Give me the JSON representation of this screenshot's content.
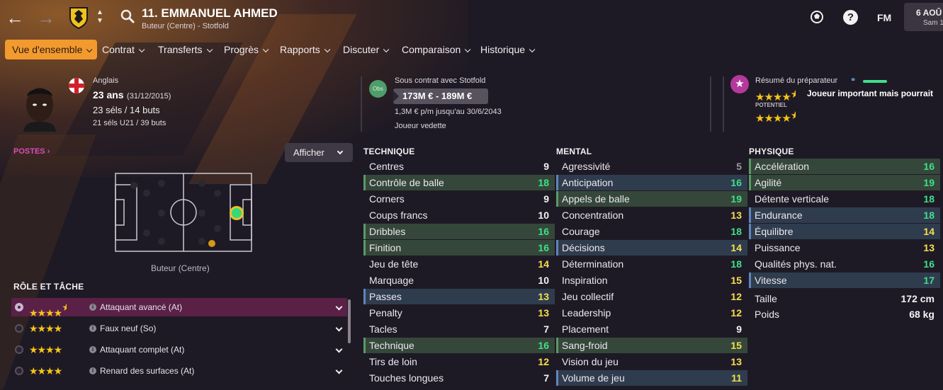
{
  "header": {
    "player_title": "11. EMMANUEL AHMED",
    "subtitle": "Buteur (Centre) - Stotfold",
    "fm_label": "FM",
    "date_day": "6 AOÛ",
    "date_weekday": "Sam 1"
  },
  "nav": {
    "items": [
      "Vue d'ensemble",
      "Contrat",
      "Transferts",
      "Progrès",
      "Rapports",
      "Discuter",
      "Comparaison",
      "Historique"
    ]
  },
  "player": {
    "nationality": "Anglais",
    "age": "23 ans",
    "birth": "(31/12/2015)",
    "caps": "23 séls / 14 buts",
    "u21": "21 séls U21 / 39 buts"
  },
  "contract": {
    "badge": "Obs",
    "status": "Sous contrat avec Stotfold",
    "value": "173M € - 189M €",
    "wage": "1,3M € p/m jusqu'au 30/6/2043",
    "role": "Joueur vedette"
  },
  "coach": {
    "title": "Résumé du préparateur",
    "summary": "Joueur important mais pourrait",
    "potential_label": "POTENTIEL",
    "ability_stars": 4.5,
    "potential_stars": 4.5
  },
  "positions": {
    "heading": "POSTES",
    "button": "Afficher",
    "label": "Buteur (Centre)"
  },
  "roles": {
    "heading": "RÔLE ET TÂCHE",
    "items": [
      {
        "name": "Attaquant avancé (At)",
        "stars": 4.5
      },
      {
        "name": "Faux neuf (So)",
        "stars": 4
      },
      {
        "name": "Attaquant complet (At)",
        "stars": 4
      },
      {
        "name": "Renard des surfaces (At)",
        "stars": 4
      }
    ]
  },
  "technique": {
    "heading": "TECHNIQUE",
    "rows": [
      [
        "Centres",
        "9"
      ],
      [
        "Contrôle de balle",
        "18"
      ],
      [
        "Corners",
        "9"
      ],
      [
        "Coups francs",
        "10"
      ],
      [
        "Dribbles",
        "16"
      ],
      [
        "Finition",
        "16"
      ],
      [
        "Jeu de tête",
        "14"
      ],
      [
        "Marquage",
        "10"
      ],
      [
        "Passes",
        "13"
      ],
      [
        "Penalty",
        "13"
      ],
      [
        "Tacles",
        "7"
      ],
      [
        "Technique",
        "16"
      ],
      [
        "Tirs de loin",
        "12"
      ],
      [
        "Touches longues",
        "7"
      ]
    ]
  },
  "mental": {
    "heading": "MENTAL",
    "rows": [
      [
        "Agressivité",
        "5"
      ],
      [
        "Anticipation",
        "16"
      ],
      [
        "Appels de balle",
        "19"
      ],
      [
        "Concentration",
        "13"
      ],
      [
        "Courage",
        "18"
      ],
      [
        "Décisions",
        "14"
      ],
      [
        "Détermination",
        "18"
      ],
      [
        "Inspiration",
        "15"
      ],
      [
        "Jeu collectif",
        "12"
      ],
      [
        "Leadership",
        "12"
      ],
      [
        "Placement",
        "9"
      ],
      [
        "Sang-froid",
        "15"
      ],
      [
        "Vision du jeu",
        "13"
      ],
      [
        "Volume de jeu",
        "11"
      ]
    ]
  },
  "physique": {
    "heading": "PHYSIQUE",
    "rows": [
      [
        "Accélération",
        "16"
      ],
      [
        "Agilité",
        "19"
      ],
      [
        "Détente verticale",
        "18"
      ],
      [
        "Endurance",
        "18"
      ],
      [
        "Équilibre",
        "14"
      ],
      [
        "Puissance",
        "13"
      ],
      [
        "Qualités phys. nat.",
        "16"
      ],
      [
        "Vitesse",
        "17"
      ]
    ],
    "height_label": "Taille",
    "height": "172 cm",
    "weight_label": "Poids",
    "weight": "68 kg"
  },
  "colors": {
    "accent": "#f29a2e",
    "green": "#3fe08a",
    "yellow": "#f5e04e",
    "purple": "#b5399c"
  }
}
